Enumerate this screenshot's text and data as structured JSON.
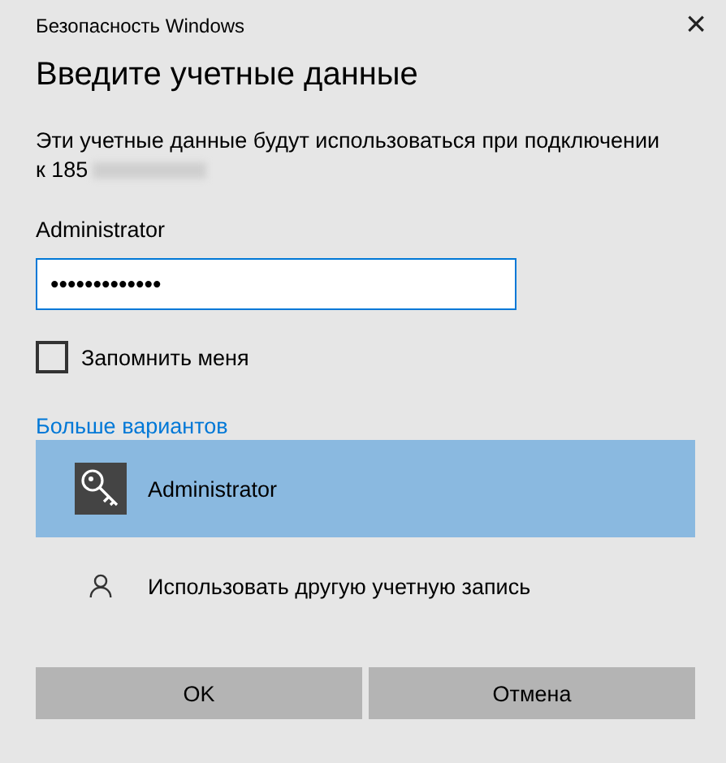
{
  "window": {
    "title": "Безопасность Windows",
    "close": "×"
  },
  "heading": "Введите учетные данные",
  "description_line1": "Эти учетные данные будут использоваться при подключении",
  "description_line2": "к 185",
  "username": "Administrator",
  "password": {
    "value": "•••••••••••••"
  },
  "remember": {
    "label": "Запомнить меня",
    "checked": false
  },
  "more_options": "Больше вариантов",
  "accounts": [
    {
      "kind": "key",
      "label": "Administrator",
      "selected": true
    },
    {
      "kind": "person",
      "label": "Использовать другую учетную запись",
      "selected": false
    }
  ],
  "buttons": [
    "OK",
    "Отмена"
  ]
}
